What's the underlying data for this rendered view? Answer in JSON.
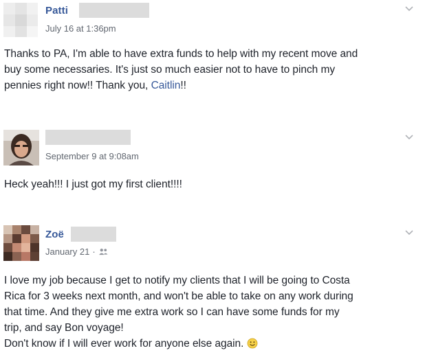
{
  "posts": [
    {
      "author": "Patti",
      "timestamp": "July 16 at 1:36pm",
      "lines_before_mention": [
        "Thanks to PA, I'm able to have extra funds to help with my recent move and",
        "buy some necessaries. It's just so much easier not to have to pinch my"
      ],
      "last_line_prefix": "pennies right now!! Thank you, ",
      "mention": "Caitlin",
      "last_line_suffix": "!!",
      "menu_icon": "chevron-down-icon",
      "avatar_icon": "blurred-profile-photo"
    },
    {
      "author": "",
      "timestamp": "September 9 at 9:08am",
      "text": "Heck yeah!!! I just got my first client!!!!",
      "menu_icon": "chevron-down-icon",
      "avatar_icon": "profile-photo"
    },
    {
      "author": "Zoë",
      "timestamp": "January 21",
      "timestamp_separator": "·",
      "audience_icon": "friends-icon",
      "lines": [
        "I love my job because I get to notify my clients that I will be going to Costa",
        "Rica for 3 weeks next month, and won't be able to take on any work during",
        "that time. And they give me extra work so I can have some funds for my",
        "trip, and say Bon voyage!"
      ],
      "final_line": "Don't know if I will ever work for anyone else again.",
      "emoji_icon": "smiley-icon",
      "menu_icon": "chevron-down-icon",
      "avatar_icon": "blurred-profile-photo"
    }
  ],
  "colors": {
    "link": "#365899",
    "text": "#1d2129",
    "meta": "#616770",
    "redaction": "#dcdcdc"
  }
}
